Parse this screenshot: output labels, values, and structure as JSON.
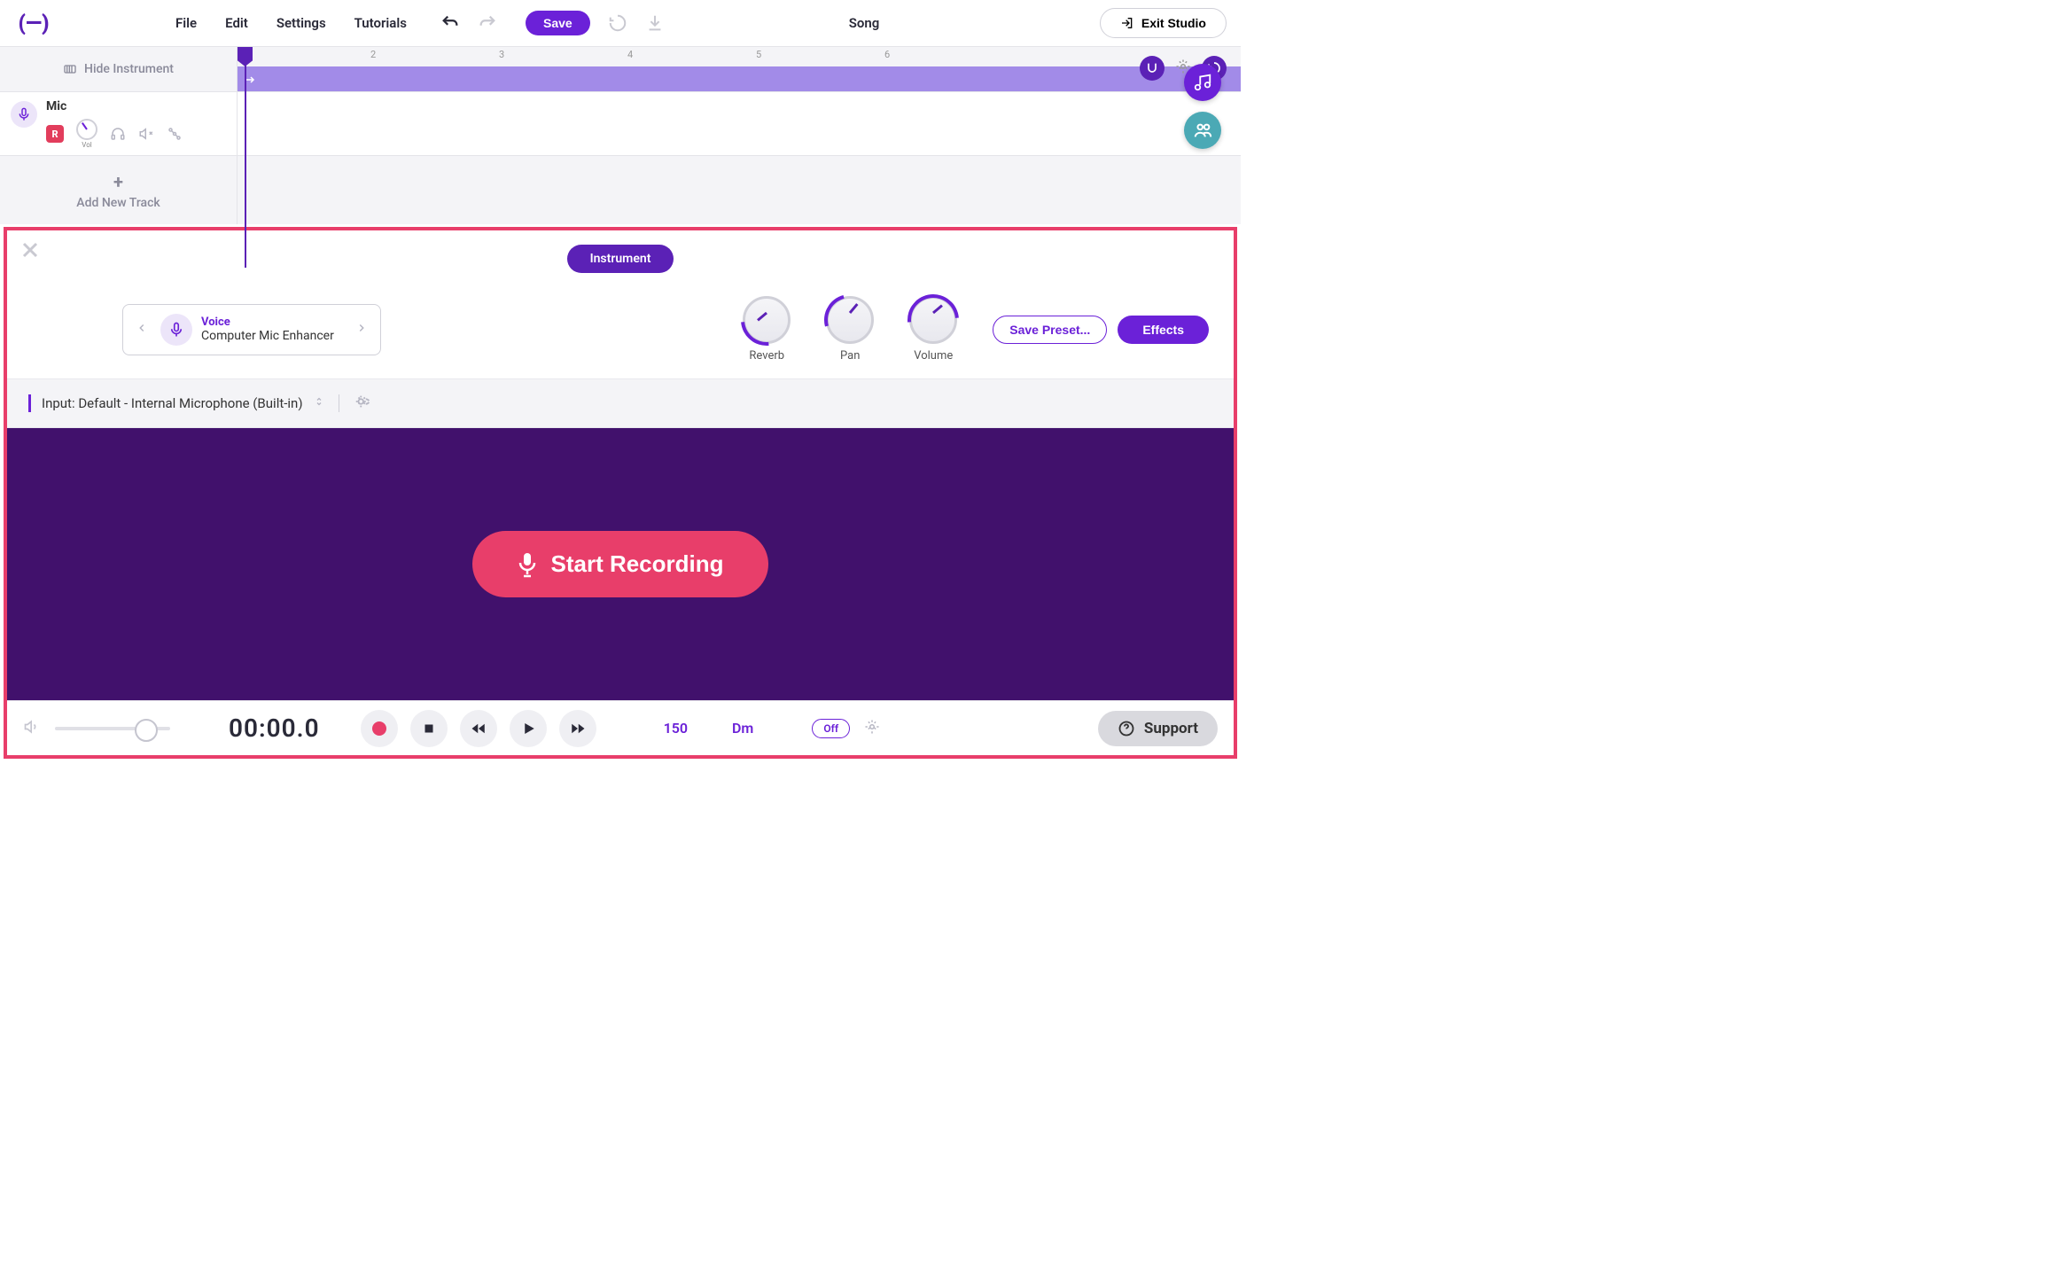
{
  "menu": {
    "file": "File",
    "edit": "Edit",
    "settings": "Settings",
    "tutorials": "Tutorials"
  },
  "toolbar": {
    "save": "Save",
    "exit": "Exit Studio",
    "song": "Song"
  },
  "sidebar": {
    "hide": "Hide Instrument",
    "track_name": "Mic",
    "rec_badge": "R",
    "vol": "Vol",
    "add": "Add New Track"
  },
  "ruler": {
    "marks": [
      "2",
      "3",
      "4",
      "5",
      "6"
    ]
  },
  "panel": {
    "tab": "Instrument",
    "preset_category": "Voice",
    "preset_name": "Computer Mic Enhancer",
    "knob_reverb": "Reverb",
    "knob_pan": "Pan",
    "knob_volume": "Volume",
    "save_preset": "Save Preset...",
    "effects": "Effects",
    "input_label": "Input: Default - Internal Microphone (Built-in)",
    "start_recording": "Start Recording"
  },
  "transport": {
    "time": "00:00.0",
    "tempo": "150",
    "key": "Dm",
    "off": "Off"
  },
  "support": "Support"
}
